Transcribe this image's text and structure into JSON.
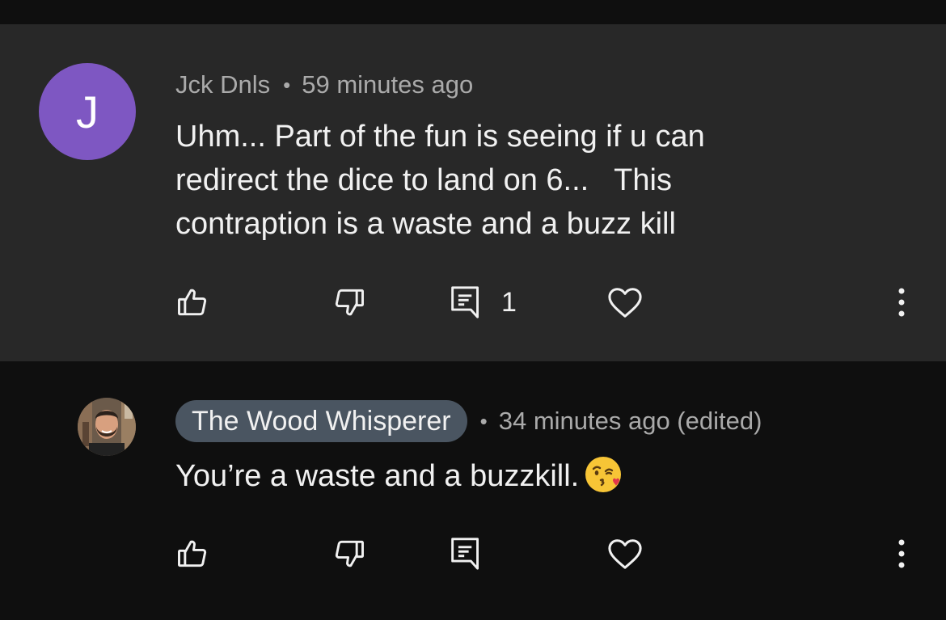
{
  "comments": [
    {
      "avatar_letter": "J",
      "avatar_color": "#7e57c2",
      "author": "Jck Dnls",
      "separator": "•",
      "time": "59 minutes ago",
      "text": "Uhm... Part of the fun is seeing if u can\nredirect the dice to land on 6...   This\ncontraption is a waste and a buzz kill",
      "reply_count": "1",
      "icons": [
        "thumbs-up-icon",
        "thumbs-down-icon",
        "reply-icon",
        "heart-icon",
        "more-vert-icon"
      ]
    },
    {
      "avatar": "profile-photo",
      "author": "The Wood Whisperer",
      "author_chip_color": "#4a5561",
      "separator": "•",
      "time": "34 minutes ago (edited)",
      "text": "You’re a waste and a buzzkill.",
      "emoji": "kissing-face-with-heart-emoji",
      "icons": [
        "thumbs-up-icon",
        "thumbs-down-icon",
        "reply-icon",
        "heart-icon",
        "more-vert-icon"
      ]
    }
  ],
  "colors": {
    "parent_background": "#282828",
    "reply_background": "#0f0f0f",
    "meta_text": "#aaaaaa",
    "body_text": "#f1f1f1"
  }
}
